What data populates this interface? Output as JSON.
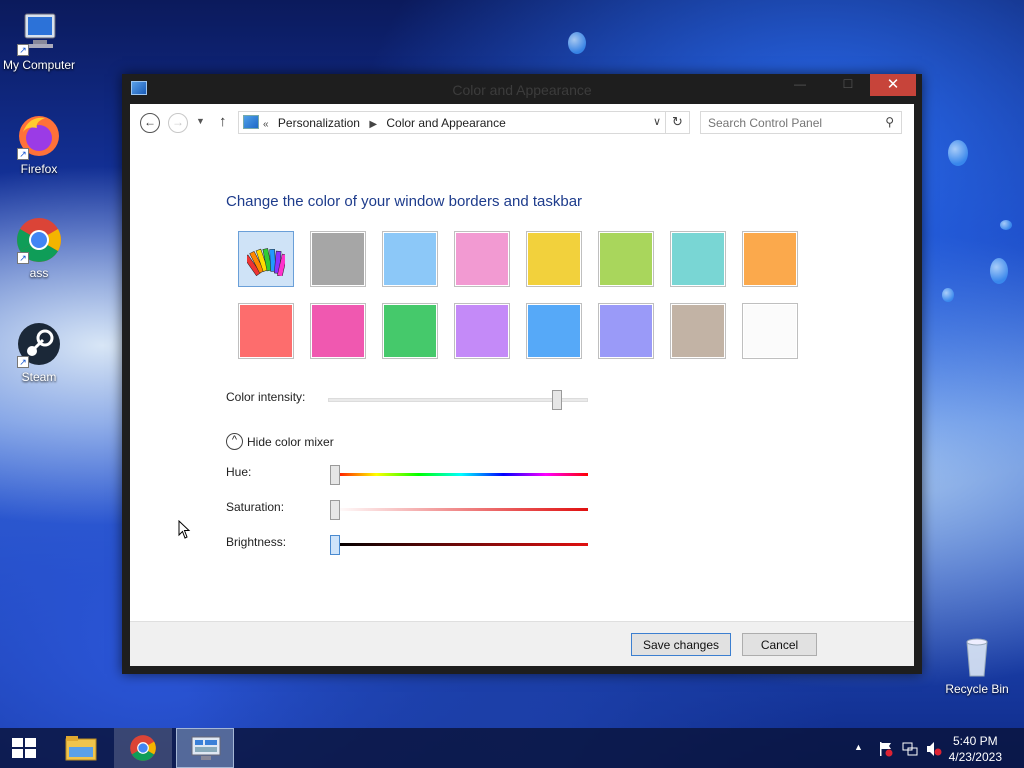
{
  "desktop": {
    "icons": [
      {
        "label": "My Computer",
        "icon": "computer-icon"
      },
      {
        "label": "Firefox",
        "icon": "firefox-icon"
      },
      {
        "label": "ass",
        "icon": "chrome-icon"
      },
      {
        "label": "Steam",
        "icon": "steam-icon"
      },
      {
        "label": "Recycle Bin",
        "icon": "recycle-bin-icon"
      }
    ]
  },
  "window": {
    "title": "Color and Appearance",
    "close_glyph": "✕",
    "nav": {
      "back_glyph": "←",
      "forward_glyph": "→",
      "recent_glyph": "▼",
      "up_glyph": "↑",
      "breadcrumb_prefix": "«",
      "breadcrumbs": [
        "Personalization",
        "Color and Appearance"
      ],
      "search_placeholder": "Search Control Panel"
    },
    "heading": "Change the color of your window borders and taskbar",
    "swatches_row1": [
      {
        "name": "automatic",
        "color": "#cfe3f7",
        "selected": true
      },
      {
        "name": "gray",
        "color": "#a6a6a6"
      },
      {
        "name": "light-blue",
        "color": "#8cc8f8"
      },
      {
        "name": "pink",
        "color": "#f29ad2"
      },
      {
        "name": "yellow",
        "color": "#f2d13c"
      },
      {
        "name": "lime",
        "color": "#a9d65c"
      },
      {
        "name": "teal",
        "color": "#79d6d4"
      },
      {
        "name": "orange",
        "color": "#fba94c"
      }
    ],
    "swatches_row2": [
      {
        "name": "red",
        "color": "#fd6d6d"
      },
      {
        "name": "magenta",
        "color": "#f058b0"
      },
      {
        "name": "green",
        "color": "#45c96b"
      },
      {
        "name": "violet",
        "color": "#c48af8"
      },
      {
        "name": "sky",
        "color": "#56a9f8"
      },
      {
        "name": "periwinkle",
        "color": "#9a9af8"
      },
      {
        "name": "taupe",
        "color": "#c2b3a5"
      },
      {
        "name": "white",
        "color": "#fbfbfb"
      }
    ],
    "intensity_label": "Color intensity:",
    "intensity_value": 0.86,
    "mixer_toggle_label": "Hide color mixer",
    "mixer_toggle_glyph": "^",
    "hue_label": "Hue:",
    "hue_value": 0,
    "saturation_label": "Saturation:",
    "saturation_value": 0,
    "brightness_label": "Brightness:",
    "brightness_value": 0,
    "save_label": "Save changes",
    "cancel_label": "Cancel"
  },
  "taskbar": {
    "time": "5:40 PM",
    "date": "4/23/2023",
    "tray_chevron": "▲",
    "pinned": [
      "file-explorer-icon",
      "chrome-icon",
      "control-panel-icon"
    ]
  },
  "colors": {
    "heading": "#1e3c8c",
    "close_button": "#c7443a",
    "accent_border": "#3c7fd0"
  }
}
